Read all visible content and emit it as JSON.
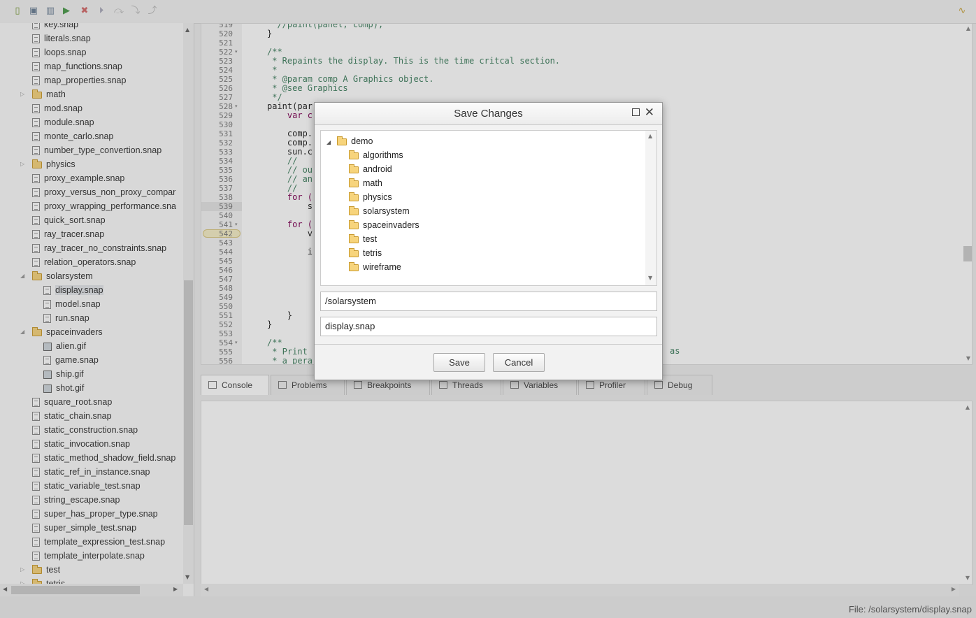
{
  "toolbar": {
    "icons": [
      "new-file-icon",
      "save-icon",
      "delete-icon",
      "run-icon",
      "stop-icon",
      "step-icon",
      "step-over-icon",
      "step-into-icon",
      "step-out-icon",
      "activity-icon"
    ]
  },
  "sidebar": {
    "items": [
      {
        "label": "key.snap",
        "type": "file"
      },
      {
        "label": "literals.snap",
        "type": "file"
      },
      {
        "label": "loops.snap",
        "type": "file"
      },
      {
        "label": "map_functions.snap",
        "type": "file"
      },
      {
        "label": "map_properties.snap",
        "type": "file"
      },
      {
        "label": "math",
        "type": "folder"
      },
      {
        "label": "mod.snap",
        "type": "file"
      },
      {
        "label": "module.snap",
        "type": "file"
      },
      {
        "label": "monte_carlo.snap",
        "type": "file"
      },
      {
        "label": "number_type_convertion.snap",
        "type": "file"
      },
      {
        "label": "physics",
        "type": "folder"
      },
      {
        "label": "proxy_example.snap",
        "type": "file"
      },
      {
        "label": "proxy_versus_non_proxy_compar",
        "type": "file"
      },
      {
        "label": "proxy_wrapping_performance.sna",
        "type": "file"
      },
      {
        "label": "quick_sort.snap",
        "type": "file"
      },
      {
        "label": "ray_tracer.snap",
        "type": "file"
      },
      {
        "label": "ray_tracer_no_constraints.snap",
        "type": "file"
      },
      {
        "label": "relation_operators.snap",
        "type": "file"
      },
      {
        "label": "solarsystem",
        "type": "folder-open"
      },
      {
        "label": "display.snap",
        "type": "file",
        "child": true,
        "selected": true
      },
      {
        "label": "model.snap",
        "type": "file",
        "child": true
      },
      {
        "label": "run.snap",
        "type": "file",
        "child": true
      },
      {
        "label": "spaceinvaders",
        "type": "folder-open"
      },
      {
        "label": "alien.gif",
        "type": "image",
        "child": true
      },
      {
        "label": "game.snap",
        "type": "file",
        "child": true
      },
      {
        "label": "ship.gif",
        "type": "image",
        "child": true
      },
      {
        "label": "shot.gif",
        "type": "image",
        "child": true
      },
      {
        "label": "square_root.snap",
        "type": "file"
      },
      {
        "label": "static_chain.snap",
        "type": "file"
      },
      {
        "label": "static_construction.snap",
        "type": "file"
      },
      {
        "label": "static_invocation.snap",
        "type": "file"
      },
      {
        "label": "static_method_shadow_field.snap",
        "type": "file"
      },
      {
        "label": "static_ref_in_instance.snap",
        "type": "file"
      },
      {
        "label": "static_variable_test.snap",
        "type": "file"
      },
      {
        "label": "string_escape.snap",
        "type": "file"
      },
      {
        "label": "super_has_proper_type.snap",
        "type": "file"
      },
      {
        "label": "super_simple_test.snap",
        "type": "file"
      },
      {
        "label": "template_expression_test.snap",
        "type": "file"
      },
      {
        "label": "template_interpolate.snap",
        "type": "file"
      },
      {
        "label": "test",
        "type": "folder"
      },
      {
        "label": "tetris",
        "type": "folder"
      }
    ]
  },
  "editor": {
    "lines": [
      {
        "n": "519",
        "text": "  //paint(panel, comp);",
        "cls": "cm"
      },
      {
        "n": "520",
        "text": "}",
        "cls": ""
      },
      {
        "n": "521",
        "text": "",
        "cls": ""
      },
      {
        "n": "522",
        "text": "/**",
        "cls": "cm"
      },
      {
        "n": "523",
        "text": " * Repaints the display. This is the time critcal section.",
        "cls": "cm"
      },
      {
        "n": "524",
        "text": " *",
        "cls": "cm"
      },
      {
        "n": "525",
        "text": " * @param comp A Graphics object.",
        "cls": "cm"
      },
      {
        "n": "526",
        "text": " * @see Graphics",
        "cls": "cm"
      },
      {
        "n": "527",
        "text": " */",
        "cls": "cm"
      },
      {
        "n": "528",
        "text": "paint(par",
        "cls": ""
      },
      {
        "n": "529",
        "text": "    var c",
        "cls": "kw"
      },
      {
        "n": "530",
        "text": "",
        "cls": ""
      },
      {
        "n": "531",
        "text": "    comp.",
        "cls": ""
      },
      {
        "n": "532",
        "text": "    comp.",
        "cls": ""
      },
      {
        "n": "533",
        "text": "    sun.c",
        "cls": ""
      },
      {
        "n": "534",
        "text": "    //",
        "cls": "cm"
      },
      {
        "n": "535",
        "text": "    // ou",
        "cls": "cm"
      },
      {
        "n": "536",
        "text": "    // an",
        "cls": "cm"
      },
      {
        "n": "537",
        "text": "    //",
        "cls": "cm"
      },
      {
        "n": "538",
        "text": "    for (",
        "cls": "kw"
      },
      {
        "n": "539",
        "text": "        s",
        "cls": ""
      },
      {
        "n": "540",
        "text": "",
        "cls": ""
      },
      {
        "n": "541",
        "text": "    for (",
        "cls": "kw"
      },
      {
        "n": "542",
        "text": "        v",
        "cls": ""
      },
      {
        "n": "543",
        "text": "",
        "cls": ""
      },
      {
        "n": "544",
        "text": "        i",
        "cls": ""
      },
      {
        "n": "545",
        "text": "",
        "cls": ""
      },
      {
        "n": "546",
        "text": "",
        "cls": ""
      },
      {
        "n": "547",
        "text": "",
        "cls": ""
      },
      {
        "n": "548",
        "text": "",
        "cls": ""
      },
      {
        "n": "549",
        "text": "",
        "cls": ""
      },
      {
        "n": "550",
        "text": "",
        "cls": ""
      },
      {
        "n": "551",
        "text": "    }",
        "cls": ""
      },
      {
        "n": "552",
        "text": "}",
        "cls": ""
      },
      {
        "n": "553",
        "text": "",
        "cls": ""
      },
      {
        "n": "554",
        "text": "/**",
        "cls": "cm"
      },
      {
        "n": "555",
        "text": " * Print",
        "cls": "cm"
      },
      {
        "n": "556",
        "text": " * a pera",
        "cls": "cm"
      }
    ],
    "trailing_text": "as"
  },
  "panel_tabs": [
    {
      "label": "Console",
      "icon": "console-icon"
    },
    {
      "label": "Problems",
      "icon": "problems-icon"
    },
    {
      "label": "Breakpoints",
      "icon": "breakpoints-icon"
    },
    {
      "label": "Threads",
      "icon": "threads-icon"
    },
    {
      "label": "Variables",
      "icon": "variables-icon"
    },
    {
      "label": "Profiler",
      "icon": "profiler-icon"
    },
    {
      "label": "Debug",
      "icon": "debug-icon"
    }
  ],
  "status": {
    "text": "File: /solarsystem/display.snap"
  },
  "dialog": {
    "title": "Save Changes",
    "root_folder": "demo",
    "folders": [
      "algorithms",
      "android",
      "math",
      "physics",
      "solarsystem",
      "spaceinvaders",
      "test",
      "tetris",
      "wireframe"
    ],
    "path_value": "/solarsystem",
    "filename_value": "display.snap",
    "save_label": "Save",
    "cancel_label": "Cancel"
  }
}
